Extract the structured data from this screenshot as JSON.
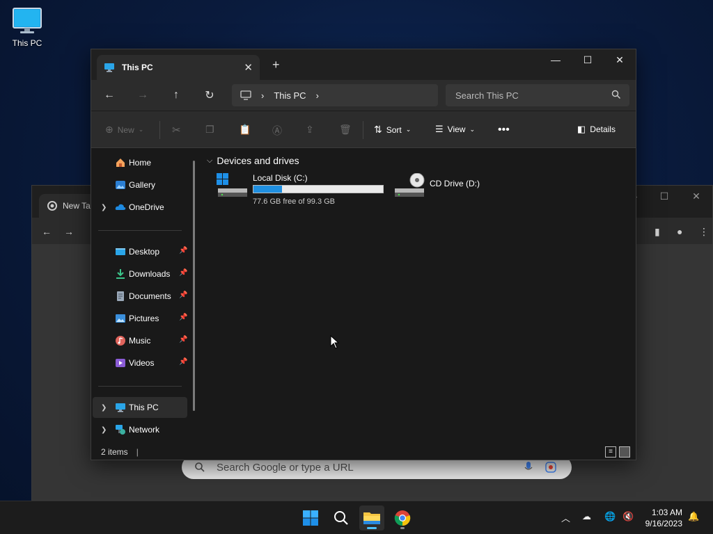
{
  "desktop": {
    "icons": [
      {
        "label": "This PC",
        "icon": "computer-icon"
      }
    ]
  },
  "chrome": {
    "tab_title": "New Tab",
    "search_placeholder": "Search Google or type a URL"
  },
  "explorer": {
    "tab_title": "This PC",
    "breadcrumb": [
      "This PC"
    ],
    "search_placeholder": "Search This PC",
    "commands": {
      "new": "New",
      "sort": "Sort",
      "view": "View",
      "details": "Details"
    },
    "nav": {
      "top": [
        {
          "label": "Home",
          "icon": "home-icon"
        },
        {
          "label": "Gallery",
          "icon": "gallery-icon"
        },
        {
          "label": "OneDrive",
          "icon": "cloud-icon",
          "expandable": true
        }
      ],
      "quick_access": [
        {
          "label": "Desktop",
          "icon": "desktop-folder-icon",
          "pinned": true
        },
        {
          "label": "Downloads",
          "icon": "download-icon",
          "pinned": true
        },
        {
          "label": "Documents",
          "icon": "documents-icon",
          "pinned": true
        },
        {
          "label": "Pictures",
          "icon": "pictures-icon",
          "pinned": true
        },
        {
          "label": "Music",
          "icon": "music-icon",
          "pinned": true
        },
        {
          "label": "Videos",
          "icon": "videos-icon",
          "pinned": true
        }
      ],
      "bottom": [
        {
          "label": "This PC",
          "icon": "computer-icon",
          "selected": true
        },
        {
          "label": "Network",
          "icon": "network-icon"
        }
      ]
    },
    "group_header": "Devices and drives",
    "drives": [
      {
        "name": "Local Disk (C:)",
        "free_text": "77.6 GB free of 99.3 GB",
        "used_fraction": 0.22,
        "icon": "windows-drive-icon"
      },
      {
        "name": "CD Drive (D:)",
        "icon": "cd-drive-icon"
      }
    ],
    "status": "2 items"
  },
  "taskbar": {
    "time": "1:03 AM",
    "date": "9/16/2023",
    "accent": "#4cc2ff"
  }
}
